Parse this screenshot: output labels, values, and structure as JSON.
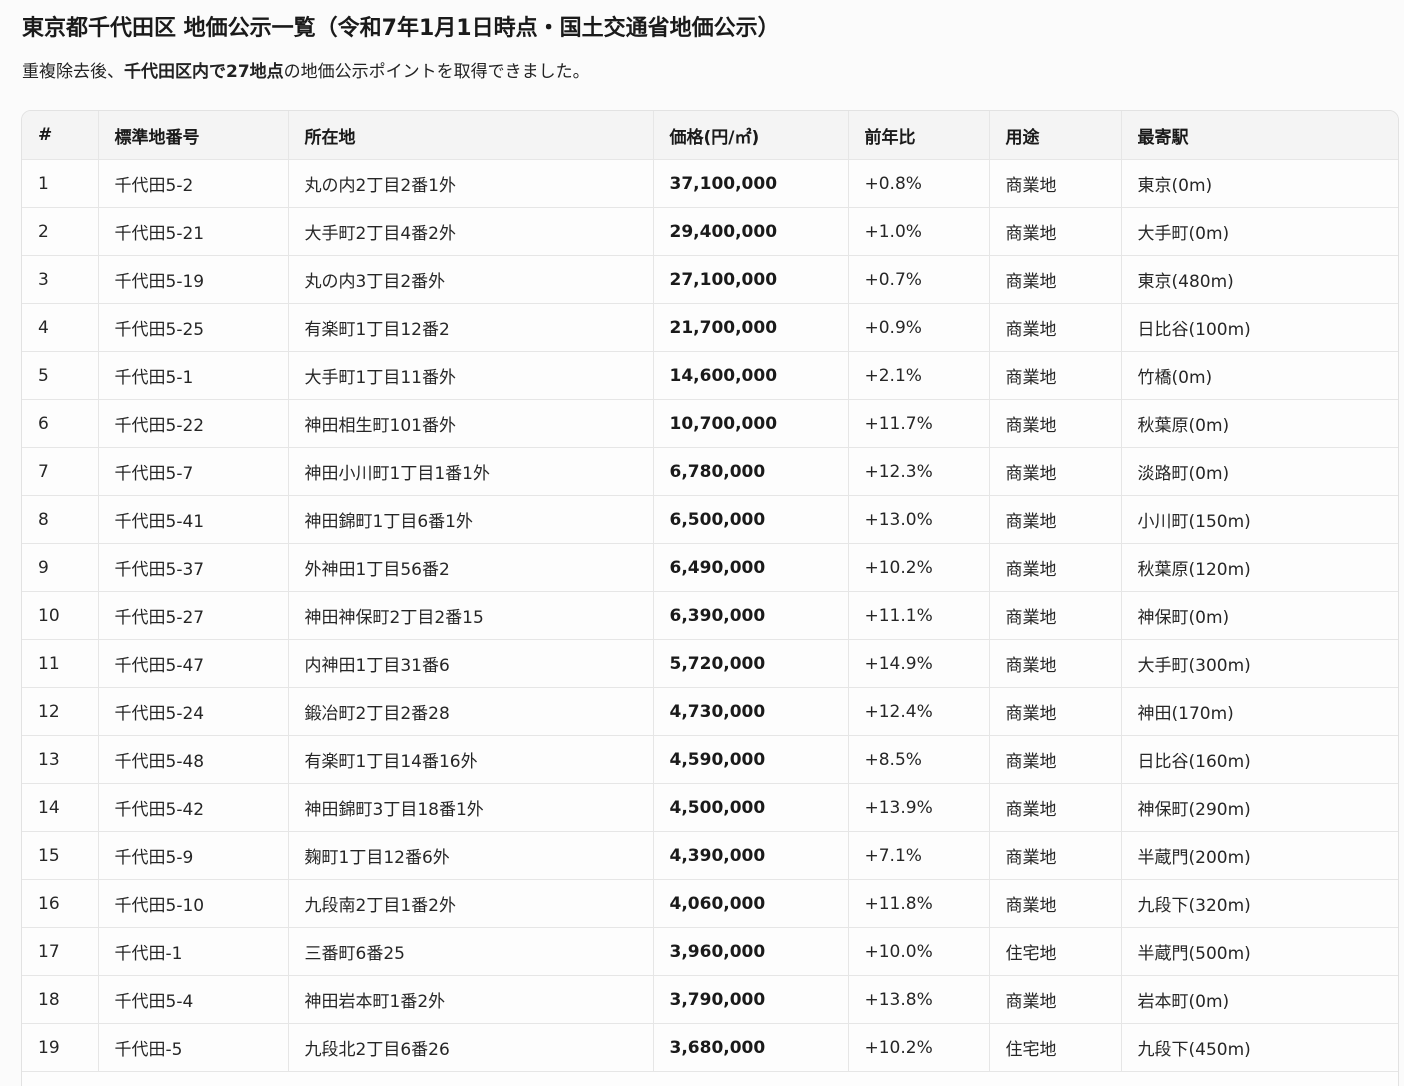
{
  "title": "東京都千代田区 地価公示一覧（令和7年1月1日時点・国土交通省地価公示）",
  "summary": {
    "prefix": "重複除去後、",
    "bold": "千代田区内で27地点",
    "suffix": "の地価公示ポイントを取得できました。"
  },
  "table": {
    "headers": [
      "#",
      "標準地番号",
      "所在地",
      "価格(円/㎡)",
      "前年比",
      "用途",
      "最寄駅"
    ],
    "rows": [
      [
        "1",
        "千代田5-2",
        "丸の内2丁目2番1外",
        "37,100,000",
        "+0.8%",
        "商業地",
        "東京(0m)"
      ],
      [
        "2",
        "千代田5-21",
        "大手町2丁目4番2外",
        "29,400,000",
        "+1.0%",
        "商業地",
        "大手町(0m)"
      ],
      [
        "3",
        "千代田5-19",
        "丸の内3丁目2番外",
        "27,100,000",
        "+0.7%",
        "商業地",
        "東京(480m)"
      ],
      [
        "4",
        "千代田5-25",
        "有楽町1丁目12番2",
        "21,700,000",
        "+0.9%",
        "商業地",
        "日比谷(100m)"
      ],
      [
        "5",
        "千代田5-1",
        "大手町1丁目11番外",
        "14,600,000",
        "+2.1%",
        "商業地",
        "竹橋(0m)"
      ],
      [
        "6",
        "千代田5-22",
        "神田相生町101番外",
        "10,700,000",
        "+11.7%",
        "商業地",
        "秋葉原(0m)"
      ],
      [
        "7",
        "千代田5-7",
        "神田小川町1丁目1番1外",
        "6,780,000",
        "+12.3%",
        "商業地",
        "淡路町(0m)"
      ],
      [
        "8",
        "千代田5-41",
        "神田錦町1丁目6番1外",
        "6,500,000",
        "+13.0%",
        "商業地",
        "小川町(150m)"
      ],
      [
        "9",
        "千代田5-37",
        "外神田1丁目56番2",
        "6,490,000",
        "+10.2%",
        "商業地",
        "秋葉原(120m)"
      ],
      [
        "10",
        "千代田5-27",
        "神田神保町2丁目2番15",
        "6,390,000",
        "+11.1%",
        "商業地",
        "神保町(0m)"
      ],
      [
        "11",
        "千代田5-47",
        "内神田1丁目31番6",
        "5,720,000",
        "+14.9%",
        "商業地",
        "大手町(300m)"
      ],
      [
        "12",
        "千代田5-24",
        "鍛冶町2丁目2番28",
        "4,730,000",
        "+12.4%",
        "商業地",
        "神田(170m)"
      ],
      [
        "13",
        "千代田5-48",
        "有楽町1丁目14番16外",
        "4,590,000",
        "+8.5%",
        "商業地",
        "日比谷(160m)"
      ],
      [
        "14",
        "千代田5-42",
        "神田錦町3丁目18番1外",
        "4,500,000",
        "+13.9%",
        "商業地",
        "神保町(290m)"
      ],
      [
        "15",
        "千代田5-9",
        "麹町1丁目12番6外",
        "4,390,000",
        "+7.1%",
        "商業地",
        "半蔵門(200m)"
      ],
      [
        "16",
        "千代田5-10",
        "九段南2丁目1番2外",
        "4,060,000",
        "+11.8%",
        "商業地",
        "九段下(320m)"
      ],
      [
        "17",
        "千代田-1",
        "三番町6番25",
        "3,960,000",
        "+10.0%",
        "住宅地",
        "半蔵門(500m)"
      ],
      [
        "18",
        "千代田5-4",
        "神田岩本町1番2外",
        "3,790,000",
        "+13.8%",
        "商業地",
        "岩本町(0m)"
      ],
      [
        "19",
        "千代田-5",
        "九段北2丁目6番26",
        "3,680,000",
        "+10.2%",
        "住宅地",
        "九段下(450m)"
      ]
    ]
  }
}
